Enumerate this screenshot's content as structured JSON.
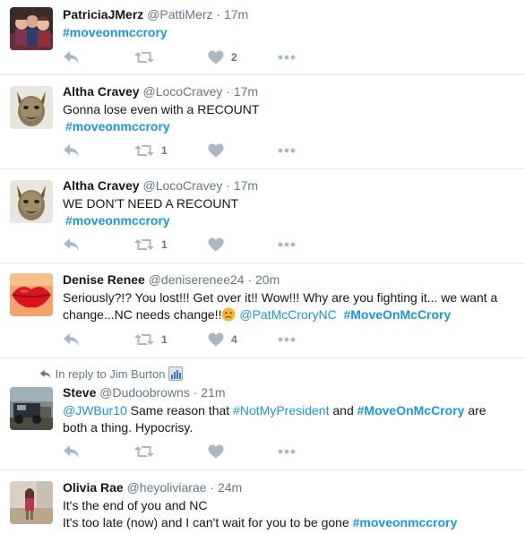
{
  "tweets": [
    {
      "fullname": "PatriciaJMerz",
      "username": "@PattiMerz",
      "time": "· 17m",
      "text_parts": [
        "#moveonmccrory"
      ],
      "retweets": "",
      "likes": "2"
    },
    {
      "fullname": "Altha Cravey",
      "username": "@LocoCravey",
      "time": "· 17m",
      "line1": "Gonna lose even with a RECOUNT",
      "hashtag": "#moveonmccrory",
      "retweets": "1",
      "likes": ""
    },
    {
      "fullname": "Altha Cravey",
      "username": "@LocoCravey",
      "time": "· 17m",
      "line1": "WE DON'T NEED A RECOUNT",
      "hashtag": "#moveonmccrory",
      "retweets": "1",
      "likes": ""
    },
    {
      "fullname": "Denise Renee",
      "username": "@deniserenee24",
      "time": "· 20m",
      "line1": "Seriously?!? You lost!!! Get over it!! Wow!!! Why are you fighting it... we want a",
      "line2_text": "change...NC needs change!!",
      "mention": "@PatMcCroryNC",
      "hashtag": "#MoveOnMcCrory",
      "retweets": "1",
      "likes": "4"
    },
    {
      "reply_context": "In reply to Jim Burton",
      "fullname": "Steve",
      "username": "@Dudoobrowns",
      "time": "· 21m",
      "mention": "@JWBur10",
      "text_a": " Same reason that ",
      "hashtag1": "#NotMyPresident",
      "text_b": " and ",
      "hashtag2": "#MoveOnMcCrory",
      "text_c": " are",
      "line2": "both a thing. Hypocrisy.",
      "retweets": "",
      "likes": ""
    },
    {
      "fullname": "Olivia Rae",
      "username": "@heyoliviarae",
      "time": "· 24m",
      "line1": "It's the end of you and NC",
      "line2_text": "It's too late (now) and I can't wait for you to be gone ",
      "hashtag": "#moveonmccrory"
    }
  ],
  "colors": {
    "link": "#1b95e0",
    "meta": "#657786",
    "icon": "#aab8c2",
    "divider": "#e1e8ed"
  },
  "icons": [
    "reply-icon",
    "retweet-icon",
    "heart-icon",
    "more-icon",
    "reply-context-arrow-icon",
    "chart-emoji-icon",
    "frown-emoji-icon"
  ]
}
